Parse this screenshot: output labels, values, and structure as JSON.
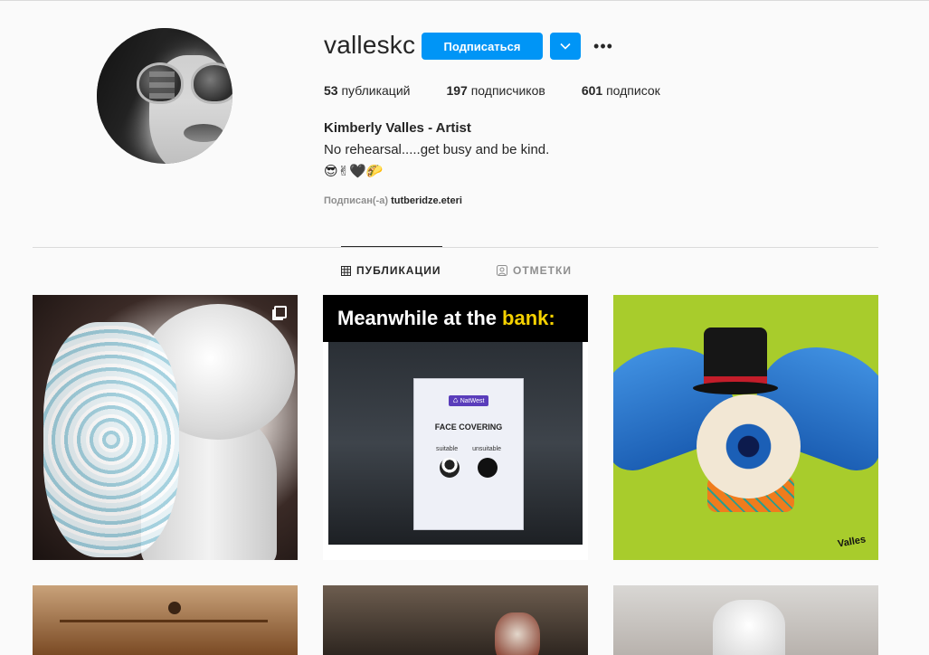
{
  "profile": {
    "username": "valleskc",
    "follow_label": "Подписаться",
    "more_label": "•••",
    "stats": {
      "posts_count": "53",
      "posts_label": "публикаций",
      "followers_count": "197",
      "followers_label": "подписчиков",
      "following_count": "601",
      "following_label": "подписок"
    },
    "full_name": "Kimberly Valles - Artist",
    "bio": "No rehearsal.....get busy and be kind.",
    "emojis": "😎✌🖤🌮",
    "followed_by_prefix": "Подписан(-а)",
    "followed_by_user": "tutberidze.eteri"
  },
  "tabs": [
    {
      "label": "ПУБЛИКАЦИИ",
      "icon": "grid-icon",
      "active": true
    },
    {
      "label": "ОТМЕТКИ",
      "icon": "tag-person-icon",
      "active": false
    }
  ],
  "posts": {
    "meme": {
      "title_prefix": "Meanwhile at the",
      "title_highlight": "bank:",
      "sign_brand": "♺ NatWest",
      "sign_title": "FACE COVERING",
      "sign_good": "suitable",
      "sign_bad": "unsuitable"
    },
    "painting_signature": "Valles"
  },
  "colors": {
    "accent": "#0095f6",
    "background": "#fafafa",
    "text": "#262626",
    "muted": "#8e8e8e"
  }
}
